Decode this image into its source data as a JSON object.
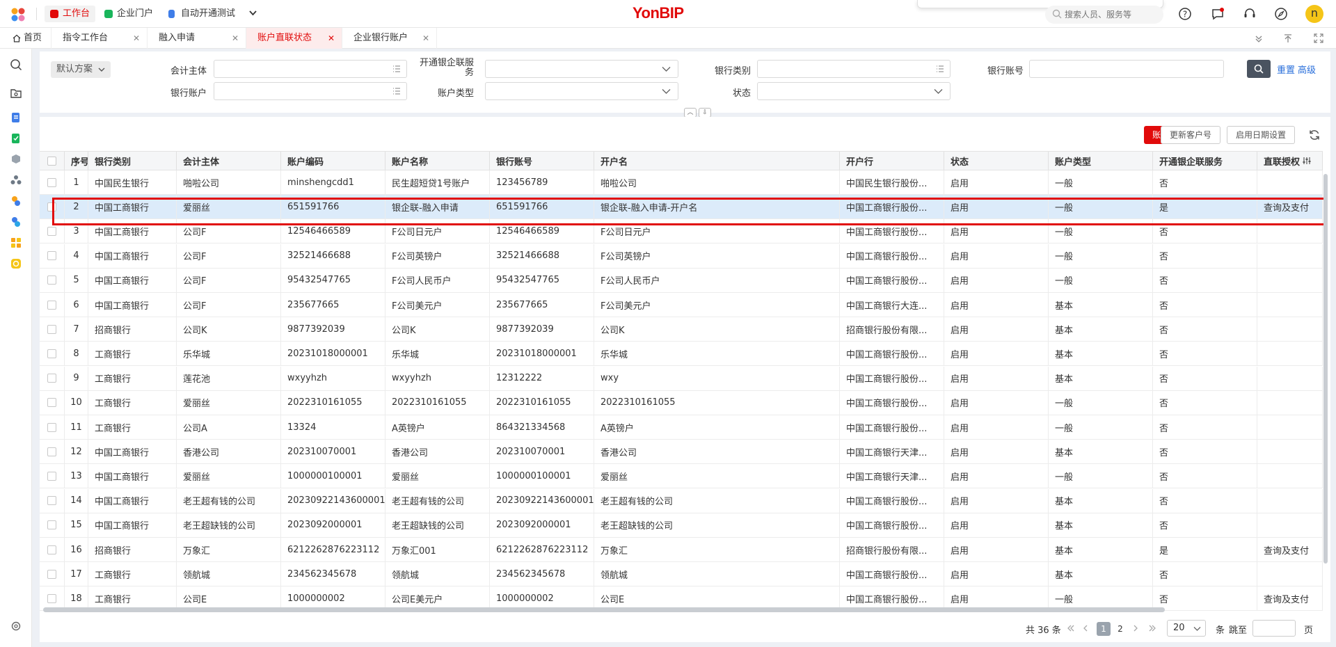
{
  "topbar": {
    "app_tabs": [
      {
        "label": "工作台",
        "color": "#e10a0a"
      },
      {
        "label": "企业门户",
        "color": "#19b55b"
      },
      {
        "label": "自动开通测试",
        "color": "#3f7de8"
      }
    ],
    "logo": "YonBIP",
    "search_placeholder": "搜索人员、服务等",
    "avatar": "n"
  },
  "tabs": [
    {
      "label": "首页"
    },
    {
      "label": "指令工作台"
    },
    {
      "label": "融入申请"
    },
    {
      "label": "账户直联状态"
    },
    {
      "label": "企业银行账户"
    }
  ],
  "filter": {
    "scheme": "默认方案",
    "labels": {
      "accounting_entity": "会计主体",
      "bank_ent_service": "开通银企联服务",
      "bank_type": "银行类别",
      "bank_account_no": "银行账号",
      "bank_account": "银行账户",
      "account_type": "账户类型",
      "status": "状态"
    },
    "reset": "重置",
    "advanced": "高级"
  },
  "toolbar": {
    "sync": "账户同步",
    "update_customer": "更新客户号",
    "enable_date": "启用日期设置"
  },
  "columns": [
    "序号",
    "银行类别",
    "会计主体",
    "账户编码",
    "账户名称",
    "银行账号",
    "开户名",
    "开户行",
    "状态",
    "账户类型",
    "开通银企联服务",
    "直联授权"
  ],
  "rows": [
    [
      "1",
      "中国民生银行",
      "啪啦公司",
      "minshengcdd1",
      "民生超短贷1号账户",
      "123456789",
      "啪啦公司",
      "中国民生银行股份...",
      "启用",
      "一般",
      "否",
      ""
    ],
    [
      "2",
      "中国工商银行",
      "爱丽丝",
      "651591766",
      "银企联-融入申请",
      "651591766",
      "银企联-融入申请-开户名",
      "中国工商银行股份...",
      "启用",
      "一般",
      "是",
      "查询及支付"
    ],
    [
      "3",
      "中国工商银行",
      "公司F",
      "12546466589",
      "F公司日元户",
      "12546466589",
      "F公司日元户",
      "中国工商银行股份...",
      "启用",
      "一般",
      "否",
      ""
    ],
    [
      "4",
      "中国工商银行",
      "公司F",
      "32521466688",
      "F公司英镑户",
      "32521466688",
      "F公司英镑户",
      "中国工商银行股份...",
      "启用",
      "一般",
      "否",
      ""
    ],
    [
      "5",
      "中国工商银行",
      "公司F",
      "95432547765",
      "F公司人民币户",
      "95432547765",
      "F公司人民币户",
      "中国工商银行股份...",
      "启用",
      "一般",
      "否",
      ""
    ],
    [
      "6",
      "中国工商银行",
      "公司F",
      "235677665",
      "F公司美元户",
      "235677665",
      "F公司美元户",
      "中国工商银行大连...",
      "启用",
      "基本",
      "否",
      ""
    ],
    [
      "7",
      "招商银行",
      "公司K",
      "9877392039",
      "公司K",
      "9877392039",
      "公司K",
      "招商银行股份有限...",
      "启用",
      "基本",
      "否",
      ""
    ],
    [
      "8",
      "工商银行",
      "乐华城",
      "20231018000001",
      "乐华城",
      "20231018000001",
      "乐华城",
      "中国工商银行股份...",
      "启用",
      "基本",
      "否",
      ""
    ],
    [
      "9",
      "工商银行",
      "莲花池",
      "wxyyhzh",
      "wxyyhzh",
      "12312222",
      "wxy",
      "中国工商银行股份...",
      "启用",
      "基本",
      "否",
      ""
    ],
    [
      "10",
      "工商银行",
      "爱丽丝",
      "2022310161055",
      "2022310161055",
      "2022310161055",
      "2022310161055",
      "中国工商银行股份...",
      "启用",
      "一般",
      "否",
      ""
    ],
    [
      "11",
      "工商银行",
      "公司A",
      "13324",
      "A英镑户",
      "864321334568",
      "A英镑户",
      "中国工商银行股份...",
      "启用",
      "一般",
      "否",
      ""
    ],
    [
      "12",
      "中国工商银行",
      "香港公司",
      "202310070001",
      "香港公司",
      "202310070001",
      "香港公司",
      "中国工商银行天津...",
      "启用",
      "基本",
      "否",
      ""
    ],
    [
      "13",
      "中国工商银行",
      "爱丽丝",
      "1000000100001",
      "爱丽丝",
      "1000000100001",
      "爱丽丝",
      "中国工商银行天津...",
      "启用",
      "一般",
      "否",
      ""
    ],
    [
      "14",
      "中国工商银行",
      "老王超有钱的公司",
      "20230922143600001",
      "老王超有钱的公司",
      "20230922143600001",
      "老王超有钱的公司",
      "中国工商银行股份...",
      "启用",
      "基本",
      "否",
      ""
    ],
    [
      "15",
      "中国工商银行",
      "老王超缺钱的公司",
      "2023092000001",
      "老王超缺钱的公司",
      "2023092000001",
      "老王超缺钱的公司",
      "中国工商银行股份...",
      "启用",
      "基本",
      "否",
      ""
    ],
    [
      "16",
      "招商银行",
      "万象汇",
      "6212262876223112",
      "万象汇001",
      "6212262876223112",
      "万象汇",
      "招商银行股份有限...",
      "启用",
      "基本",
      "是",
      "查询及支付"
    ],
    [
      "17",
      "工商银行",
      "领航城",
      "234562345678",
      "领航城",
      "234562345678",
      "领航城",
      "中国工商银行股份...",
      "启用",
      "基本",
      "否",
      ""
    ],
    [
      "18",
      "工商银行",
      "公司E",
      "1000000002",
      "公司E美元户",
      "1000000002",
      "公司E",
      "中国工商银行股份...",
      "启用",
      "一般",
      "否",
      "查询及支付"
    ]
  ],
  "pagination": {
    "total": "共 36 条",
    "pages": [
      "1",
      "2"
    ],
    "current": "1",
    "page_size": "20",
    "unit": "条",
    "jump_label": "跳至",
    "page_suffix": "页"
  },
  "colors": {
    "accent": "#e10a0a",
    "selected_row": "#dcebfa",
    "link": "#2a6fdb"
  }
}
